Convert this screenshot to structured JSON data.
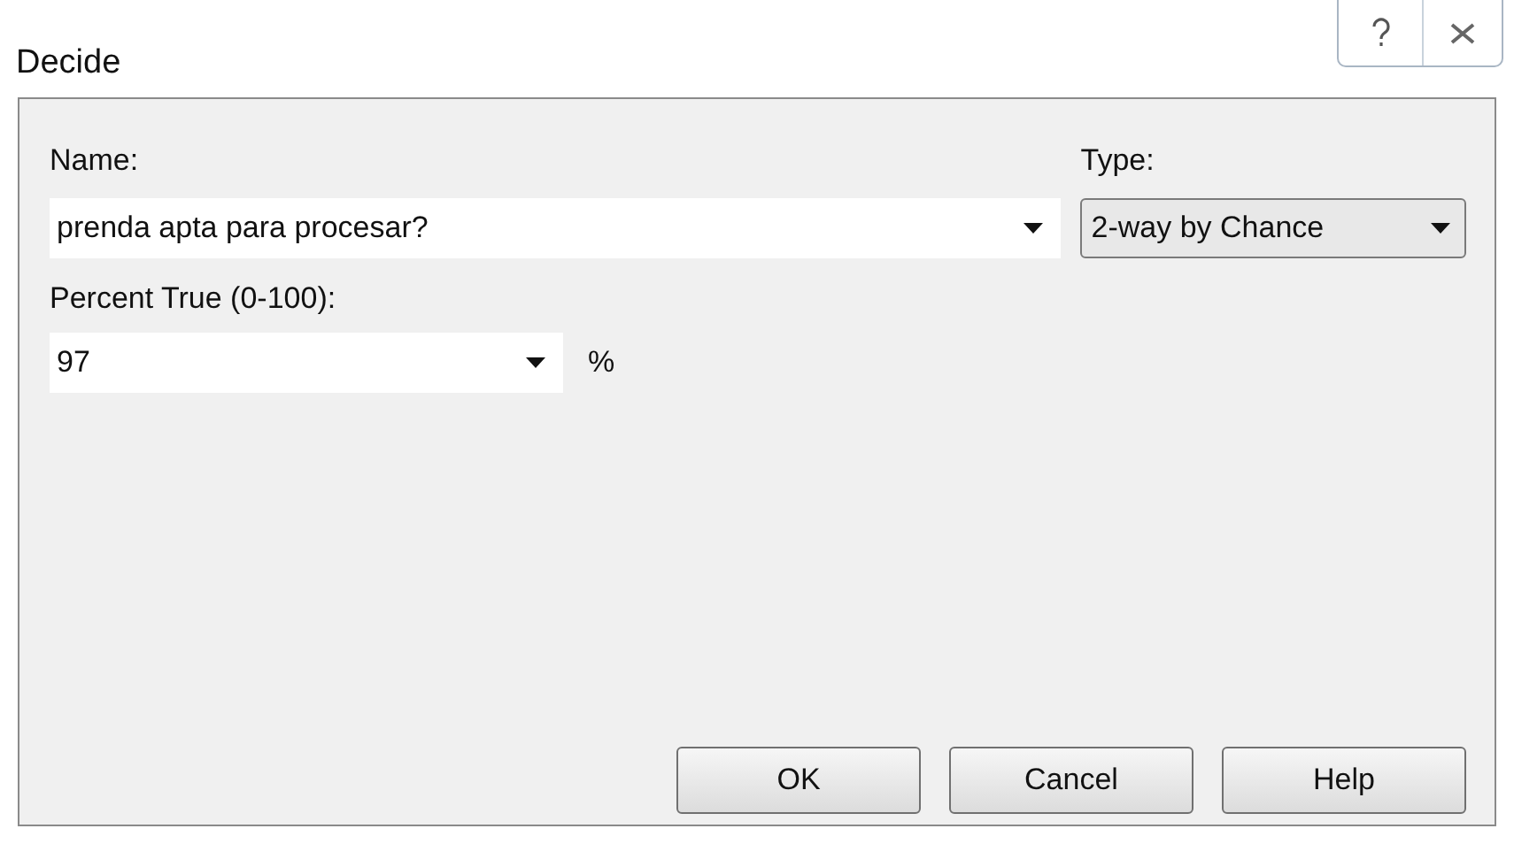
{
  "window": {
    "title": "Decide"
  },
  "name_field": {
    "label": "Name:",
    "value": "prenda apta para procesar?"
  },
  "type_field": {
    "label": "Type:",
    "value": "2-way by Chance"
  },
  "percent_field": {
    "label": "Percent True (0-100):",
    "value": "97",
    "unit": "%"
  },
  "buttons": [
    "OK",
    "Cancel",
    "Help"
  ]
}
